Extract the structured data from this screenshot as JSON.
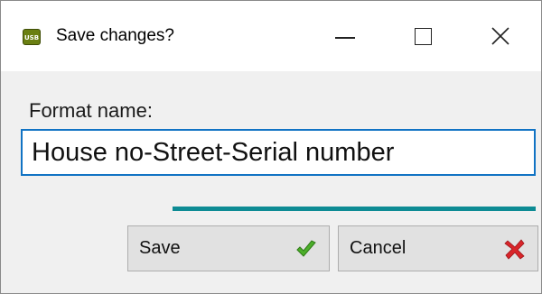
{
  "window": {
    "app_icon_text": "USB",
    "title": "Save changes?"
  },
  "form": {
    "label": "Format name:",
    "input_value": "House no-Street-Serial number"
  },
  "buttons": {
    "save_label": "Save",
    "cancel_label": "Cancel"
  },
  "icons": {
    "save": "check-icon",
    "cancel": "x-icon",
    "minimize": "minimize-icon",
    "maximize": "maximize-icon",
    "close": "close-icon"
  },
  "colors": {
    "accent": "#1173c4",
    "progress": "#0d8b94",
    "check": "#4caf2a",
    "cross": "#d9252a"
  }
}
